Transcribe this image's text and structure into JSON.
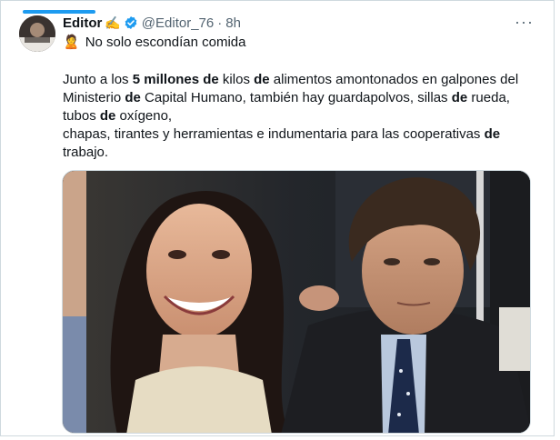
{
  "tweet": {
    "author_name": "Editor",
    "author_emoji": "✍️",
    "handle": "@Editor_76",
    "separator": "·",
    "time": "8h",
    "more_label": "···",
    "subline_emoji": "🙎",
    "subline_text": "No solo escondían comida",
    "body": {
      "l1_a": "Junto a los ",
      "l1_b": "5 millones de",
      "l1_c": " kilos ",
      "l1_d": "de",
      "l1_e": " alimentos amontonados en galpones del",
      "l2_a": "Ministerio ",
      "l2_b": "de",
      "l2_c": " Capital Humano, también hay guardapolvos, sillas ",
      "l2_d": "de",
      "l2_e": " rueda,",
      "l3_a": "tubos ",
      "l3_b": "de",
      "l3_c": " oxígeno,",
      "l4_a": "chapas, tirantes y herramientas e indumentaria para las cooperativas ",
      "l4_b": "de",
      "l5_a": "trabajo."
    }
  },
  "icons": {
    "verified": "verified-badge-icon",
    "more": "more-options-icon",
    "avatar": "avatar-image"
  },
  "colors": {
    "accent": "#1d9bf0",
    "text": "#0f1419",
    "muted": "#536471",
    "border": "#cfd9de"
  }
}
